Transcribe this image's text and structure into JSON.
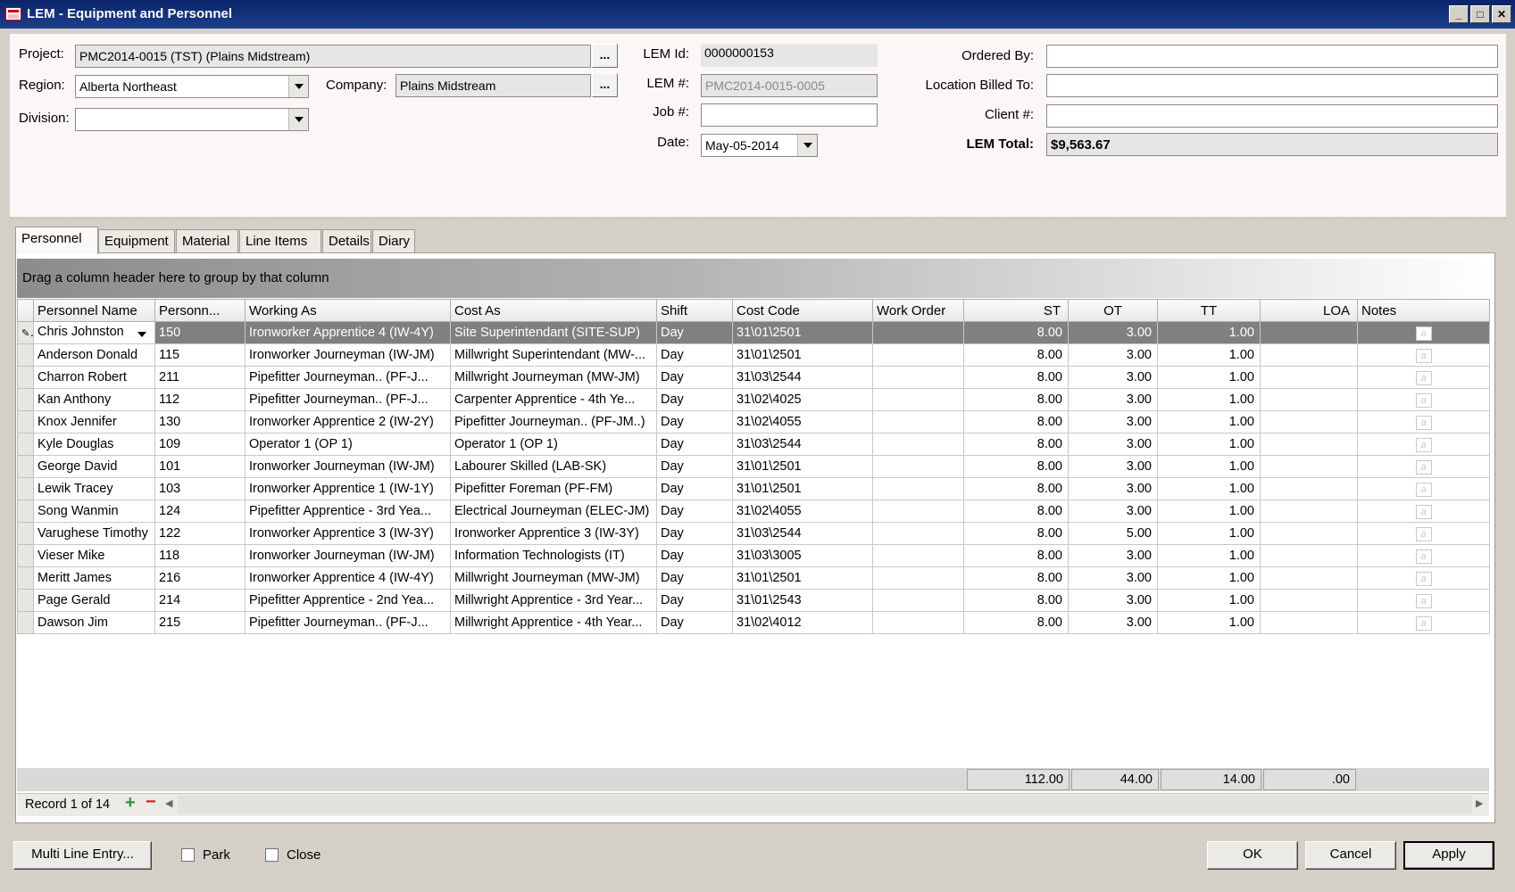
{
  "window": {
    "title": "LEM - Equipment and Personnel"
  },
  "header": {
    "project_label": "Project:",
    "project_value": "PMC2014-0015 (TST) (Plains Midstream)",
    "region_label": "Region:",
    "region_value": "Alberta Northeast",
    "company_label": "Company:",
    "company_value": "Plains Midstream",
    "division_label": "Division:",
    "division_value": "",
    "lem_id_label": "LEM Id:",
    "lem_id_value": "0000000153",
    "lem_num_label": "LEM #:",
    "lem_num_value": "PMC2014-0015-0005",
    "job_num_label": "Job #:",
    "job_num_value": "",
    "date_label": "Date:",
    "date_value": "May-05-2014",
    "ordered_by_label": "Ordered By:",
    "ordered_by_value": "",
    "location_billed_label": "Location Billed To:",
    "location_billed_value": "",
    "client_num_label": "Client #:",
    "client_num_value": "",
    "lem_total_label": "LEM Total:",
    "lem_total_value": "$9,563.67",
    "ellipsis": "..."
  },
  "tabs": [
    "Personnel",
    "Equipment",
    "Material",
    "Line Items",
    "Details",
    "Diary"
  ],
  "grid": {
    "group_hint": "Drag a column header here to group by that column",
    "columns": [
      "Personnel Name",
      "Personn...",
      "Working As",
      "Cost As",
      "Shift",
      "Cost Code",
      "Work Order",
      "ST",
      "OT",
      "TT",
      "LOA",
      "Notes"
    ],
    "rows": [
      [
        "Chris Johnston",
        "150",
        "Ironworker Apprentice 4 (IW-4Y)",
        "Site Superintendant (SITE-SUP)",
        "Day",
        "31\\01\\2501",
        "",
        "8.00",
        "3.00",
        "1.00",
        ""
      ],
      [
        "Anderson Donald",
        "115",
        "Ironworker Journeyman (IW-JM)",
        "Millwright Superintendant (MW-...",
        "Day",
        "31\\01\\2501",
        "",
        "8.00",
        "3.00",
        "1.00",
        ""
      ],
      [
        "Charron Robert",
        "211",
        "Pipefitter Journeyman.. (PF-J...",
        "Millwright Journeyman (MW-JM)",
        "Day",
        "31\\03\\2544",
        "",
        "8.00",
        "3.00",
        "1.00",
        ""
      ],
      [
        "Kan Anthony",
        "112",
        "Pipefitter Journeyman.. (PF-J...",
        "Carpenter Apprentice - 4th Ye...",
        "Day",
        "31\\02\\4025",
        "",
        "8.00",
        "3.00",
        "1.00",
        ""
      ],
      [
        "Knox Jennifer",
        "130",
        "Ironworker Apprentice 2 (IW-2Y)",
        "Pipefitter Journeyman.. (PF-JM..)",
        "Day",
        "31\\02\\4055",
        "",
        "8.00",
        "3.00",
        "1.00",
        ""
      ],
      [
        "Kyle Douglas",
        "109",
        "Operator 1 (OP 1)",
        "Operator 1 (OP 1)",
        "Day",
        "31\\03\\2544",
        "",
        "8.00",
        "3.00",
        "1.00",
        ""
      ],
      [
        "George David",
        "101",
        "Ironworker Journeyman (IW-JM)",
        "Labourer Skilled (LAB-SK)",
        "Day",
        "31\\01\\2501",
        "",
        "8.00",
        "3.00",
        "1.00",
        ""
      ],
      [
        "Lewik Tracey",
        "103",
        "Ironworker Apprentice 1 (IW-1Y)",
        "Pipefitter Foreman (PF-FM)",
        "Day",
        "31\\01\\2501",
        "",
        "8.00",
        "3.00",
        "1.00",
        ""
      ],
      [
        "Song Wanmin",
        "124",
        "Pipefitter Apprentice - 3rd Yea...",
        "Electrical Journeyman (ELEC-JM)",
        "Day",
        "31\\02\\4055",
        "",
        "8.00",
        "3.00",
        "1.00",
        ""
      ],
      [
        "Varughese Timothy",
        "122",
        "Ironworker Apprentice 3 (IW-3Y)",
        "Ironworker Apprentice 3 (IW-3Y)",
        "Day",
        "31\\03\\2544",
        "",
        "8.00",
        "5.00",
        "1.00",
        ""
      ],
      [
        "Vieser Mike",
        "118",
        "Ironworker Journeyman (IW-JM)",
        "Information Technologists (IT)",
        "Day",
        "31\\03\\3005",
        "",
        "8.00",
        "3.00",
        "1.00",
        ""
      ],
      [
        "Meritt James",
        "216",
        "Ironworker Apprentice 4 (IW-4Y)",
        "Millwright Journeyman (MW-JM)",
        "Day",
        "31\\01\\2501",
        "",
        "8.00",
        "3.00",
        "1.00",
        ""
      ],
      [
        "Page Gerald",
        "214",
        "Pipefitter Apprentice - 2nd Yea...",
        "Millwright Apprentice - 3rd Year...",
        "Day",
        "31\\01\\2543",
        "",
        "8.00",
        "3.00",
        "1.00",
        ""
      ],
      [
        "Dawson Jim",
        "215",
        "Pipefitter Journeyman.. (PF-J...",
        "Millwright Apprentice - 4th Year...",
        "Day",
        "31\\02\\4012",
        "",
        "8.00",
        "3.00",
        "1.00",
        ""
      ]
    ],
    "note_glyph": "a",
    "totals": {
      "st": "112.00",
      "ot": "44.00",
      "tt": "14.00",
      "loa": ".00"
    },
    "record_text": "Record 1 of 14"
  },
  "footer": {
    "multi_line_label": "Multi Line Entry...",
    "park_label": "Park",
    "close_label": "Close",
    "ok_label": "OK",
    "cancel_label": "Cancel",
    "apply_label": "Apply"
  }
}
